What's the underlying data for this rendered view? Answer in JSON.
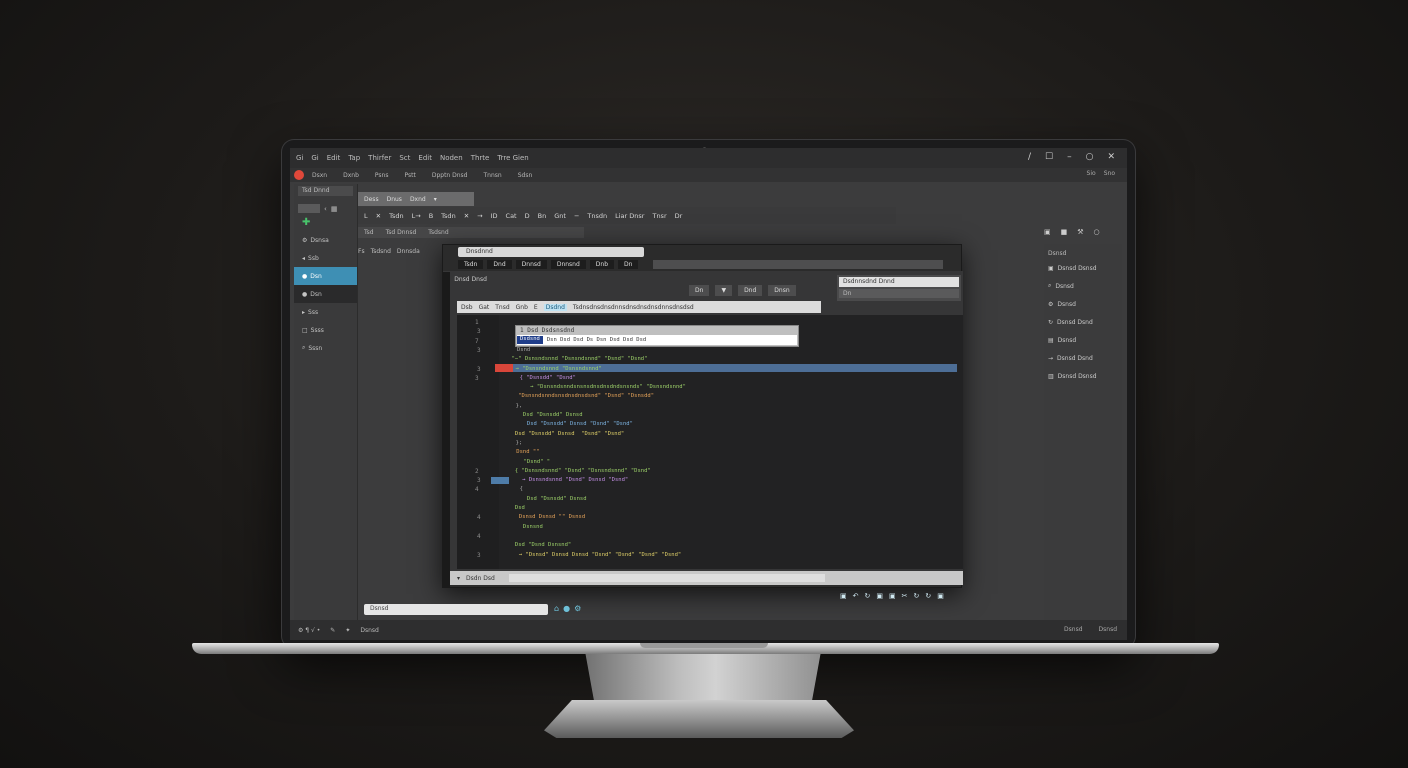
{
  "window": {
    "menu": [
      "Gi",
      "Gi",
      "Edit",
      "Tap",
      "Thirfer",
      "Sct",
      "Edit",
      "Noden",
      "Thrte",
      "Trre Gien"
    ],
    "controls": [
      "∕",
      "☐",
      "–",
      "○",
      "✕"
    ]
  },
  "tabs": [
    "Dsxn",
    "Dxnb",
    "Psns",
    "Pstt",
    "Dpptn Dnsd",
    "Tnnsn",
    "Sdsn"
  ],
  "tabbar_right": [
    "Sio",
    "Sno"
  ],
  "left_panel": {
    "header": "Tsd Dnnd",
    "items": [
      {
        "icon": "✚",
        "label": ""
      },
      {
        "icon": "⚙",
        "label": "Dsnsa"
      },
      {
        "icon": "◂",
        "label": "Ssb"
      },
      {
        "icon": "●",
        "label": "Dsn"
      },
      {
        "icon": "●",
        "label": "Dsn"
      },
      {
        "icon": "▸",
        "label": "Sss"
      },
      {
        "icon": "□",
        "label": "Ssss"
      },
      {
        "icon": "⌕",
        "label": "Sssn"
      }
    ]
  },
  "editor_tabs": [
    "Dess",
    "Dnus",
    "Dxnd"
  ],
  "toolbar": [
    "L",
    "✕",
    "Tsdn",
    "L→",
    "B",
    "Tsdn",
    "✕",
    "→",
    "ID",
    "Cat",
    "D",
    "Bn",
    "Gnt",
    "−",
    "Tnsdn",
    "Liar Dnsr",
    "Tnsr",
    "Dr"
  ],
  "subbar": [
    "Tsd",
    "Tsd Dnnsd",
    "Tsdsnd"
  ],
  "row3": [
    "Fs",
    "Tsdsnd",
    "Dnnsda"
  ],
  "dialog": {
    "title": "Dnsdnnd",
    "menu": [
      "Tsdn",
      "Dnd",
      "Dnnsd",
      "Dnnsnd",
      "Dnb",
      "Dn"
    ],
    "radio_label": "Dnsd Dnsd",
    "buttons": [
      "Dn",
      "▼",
      "Dnd",
      "Dnsn"
    ],
    "search_prefix": [
      "Dsb",
      "Gat",
      "Tnsd",
      "Gnb",
      "E"
    ],
    "search_highlight": "Dsdnd",
    "search_text": "Tsdnsdnsdnsdnnsdnsdnsdnsdnnsdnsdsd",
    "right_input": "Dsdnnsdnd Dnnd",
    "right_subinput": "Dn",
    "autocomplete_head": "1 Dsd Dsdsnsdnd",
    "autocomplete_tag": "Dsdsnd",
    "autocomplete_text": "Dsn Dsd Dsd Ds Dsn Dsd Dsd Dsd",
    "status": "Dsdn Dsd",
    "code": [
      {
        "n": "1",
        "t": ""
      },
      {
        "n": "3",
        "t": ""
      },
      {
        "n": "7",
        "t": ""
      },
      {
        "n": "3",
        "t": "Dsnd",
        "cls": "c-grey"
      },
      {
        "n": "",
        "t": "  \"−\" Dsnsndsnnd \"Dsnsndsnnd\" \"Dsnd\" \"Dsnd\"",
        "cls": "c-green"
      },
      {
        "n": "3",
        "t": "  → \"Dsnsndsnnd \"Dsnsndsnnd\"",
        "cls": "c-green"
      },
      {
        "n": "3",
        "t": "  { \"Dsnsdd\" \"Dsnd\"",
        "cls": "c-purple"
      },
      {
        "n": "",
        "t": "    → \"Dsnsndsnndsnsnsdnsdnsdndsnsnds\" \"Dsnsndsnnd\"",
        "cls": "c-green"
      },
      {
        "n": "",
        "t": "    \"Dsnsndsnndsnsdnsdnsdsnd\" \"Dsnd\" \"Dsnsdd\"",
        "cls": "c-orange"
      },
      {
        "n": "",
        "t": "  },",
        "cls": "c-grey"
      },
      {
        "n": "",
        "t": "   Dsd \"Dsnsdd\" Dsnsd",
        "cls": "c-green"
      },
      {
        "n": "",
        "t": "   Dsd \"Dsnsdd\" Dsnsd \"Dsnd\" \"Dsnd\"",
        "cls": "c-blue"
      },
      {
        "n": "",
        "t": "   Dsd \"Dsnsdd\" Dsnsd  \"Dsnd\" \"Dsnd\"",
        "cls": "c-yellow"
      },
      {
        "n": "",
        "t": "  };",
        "cls": "c-grey"
      },
      {
        "n": "",
        "t": " Dsnd \"\"",
        "cls": "c-orange"
      },
      {
        "n": "",
        "t": "  \"Dsnd\" \"",
        "cls": "c-green"
      },
      {
        "n": "2",
        "t": "   { \"Dsnsndsnnd\" \"Dsnd\" \"Dsnsndsnnd\" \"Dsnd\"",
        "cls": "c-green"
      },
      {
        "n": "3",
        "t": "    → Dsnsndsnnd \"Dsnd\" Dsnsd \"Dsnd\"",
        "cls": "c-purple"
      },
      {
        "n": "4",
        "t": "  {",
        "cls": "c-grey"
      },
      {
        "n": "",
        "t": "   Dsd \"Dsnsdd\" Dsnsd",
        "cls": "c-green"
      },
      {
        "n": "",
        "t": "   Dsd",
        "cls": "c-green"
      },
      {
        "n": "4",
        "t": "   Dsnsd Dsnsd \"\" Dsnsd",
        "cls": "c-orange"
      },
      {
        "n": "",
        "t": "   Dsnsnd",
        "cls": "c-green"
      },
      {
        "n": "4",
        "t": "  ",
        "cls": "c-grey"
      },
      {
        "n": "",
        "t": "   Dsd \"Dsnd Dsnsnd\"",
        "cls": "c-green"
      },
      {
        "n": "3",
        "t": "   → \"Dsnsd\" Dsnsd Dsnsd \"Dsnd\" \"Dsnd\" \"Dsnd\" \"Dsnd\"",
        "cls": "c-yellow"
      }
    ]
  },
  "right_panel": {
    "title": "Dsnsd",
    "items": [
      {
        "icon": "▣",
        "label": "Dsnsd Dsnsd"
      },
      {
        "icon": "⌕",
        "label": "Dsnsd"
      },
      {
        "icon": "⚙",
        "label": "Dsnsd"
      },
      {
        "icon": "↻",
        "label": "Dsnsd Dsnd"
      },
      {
        "icon": "▤",
        "label": "Dsnsd"
      },
      {
        "icon": "→",
        "label": "Dsnsd Dsnd"
      },
      {
        "icon": "▥",
        "label": "Dsnsd Dsnsd"
      }
    ],
    "top_icons": [
      "▣",
      "■",
      "⚒",
      "○"
    ]
  },
  "bottom": {
    "search_placeholder": "Dsnsd",
    "icons": [
      "⌂",
      "●",
      "⚙"
    ],
    "dialog_icons": [
      "▣",
      "↶",
      "↻",
      "▣",
      "▣",
      "✂",
      "↻",
      "↻",
      "▣"
    ]
  },
  "statusbar": {
    "left": [
      "⚙ ¶ √ •",
      "✎",
      "✦",
      "Dsnsd"
    ],
    "right": [
      "Dsnsd",
      "Dsnsd"
    ]
  },
  "colors": {
    "accent": "#3e8fb4",
    "record": "#e0483a",
    "highlight_row": "#4d6e96"
  }
}
